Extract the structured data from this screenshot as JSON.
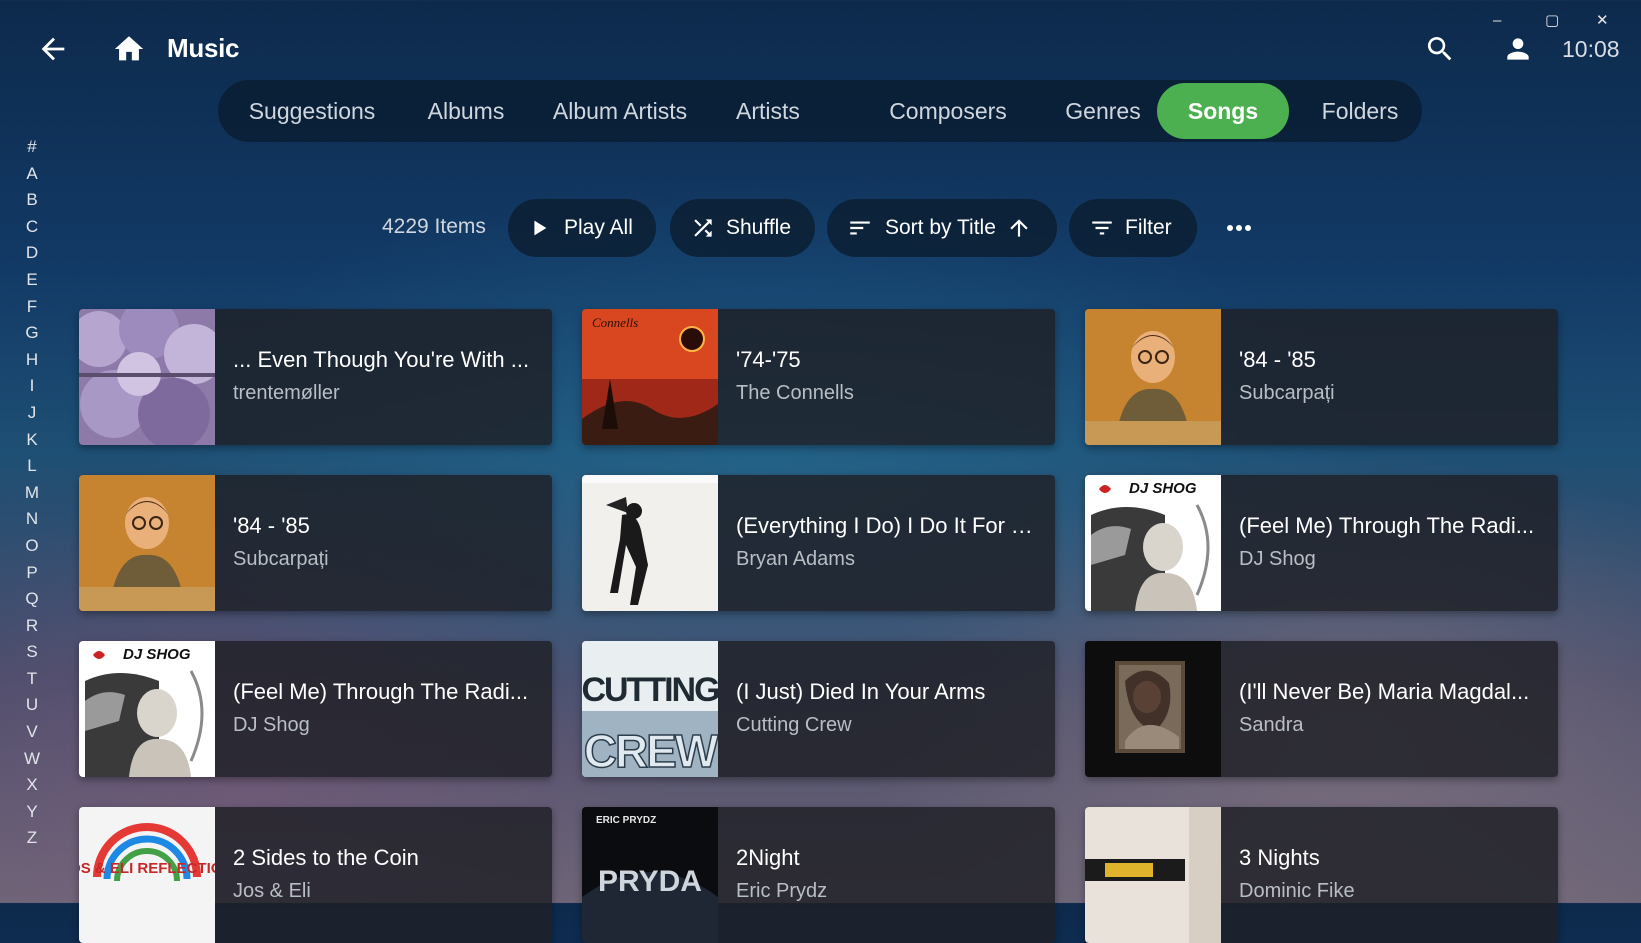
{
  "window": {
    "minimize_glyph": "–",
    "maximize_glyph": "▢",
    "close_glyph": "✕"
  },
  "header": {
    "title": "Music",
    "clock": "10:08",
    "icons": [
      "back-arrow-icon",
      "home-icon",
      "search-icon",
      "user-icon"
    ]
  },
  "tabs": [
    {
      "label": "Suggestions",
      "active": false
    },
    {
      "label": "Albums",
      "active": false
    },
    {
      "label": "Album Artists",
      "active": false
    },
    {
      "label": "Artists",
      "active": false
    },
    {
      "label": "Composers",
      "active": false
    },
    {
      "label": "Genres",
      "active": false
    },
    {
      "label": "Songs",
      "active": true
    },
    {
      "label": "Folders",
      "active": false
    }
  ],
  "alphabet": [
    "#",
    "A",
    "B",
    "C",
    "D",
    "E",
    "F",
    "G",
    "H",
    "I",
    "J",
    "K",
    "L",
    "M",
    "N",
    "O",
    "P",
    "Q",
    "R",
    "S",
    "T",
    "U",
    "V",
    "W",
    "X",
    "Y",
    "Z"
  ],
  "toolbar": {
    "count": "4229 Items",
    "play_all": "Play All",
    "shuffle": "Shuffle",
    "sort": "Sort by Title",
    "filter": "Filter",
    "more_glyph": "•••"
  },
  "colors": {
    "accent": "#4caf50",
    "tabbar_bg": "#0b1d30"
  },
  "songs": [
    {
      "title": "... Even Though You're With ...",
      "artist": "trentemøller",
      "art": "purple-smoke-art",
      "art_text": ""
    },
    {
      "title": "'74-'75",
      "artist": "The Connells",
      "art": "connells-ring-art",
      "art_text": "Connells"
    },
    {
      "title": "'84 - '85",
      "artist": "Subcarpați",
      "art": "child-portrait-art",
      "art_text": ""
    },
    {
      "title": "'84 - '85",
      "artist": "Subcarpați",
      "art": "child-portrait-art",
      "art_text": ""
    },
    {
      "title": "(Everything I Do) I Do It For Y...",
      "artist": "Bryan Adams",
      "art": "bryan-adams-art",
      "art_text": ""
    },
    {
      "title": "(Feel Me) Through The Radi...",
      "artist": "DJ Shog",
      "art": "dj-shog-art",
      "art_text": "DJ SHOG"
    },
    {
      "title": "(Feel Me) Through The Radi...",
      "artist": "DJ Shog",
      "art": "dj-shog-art",
      "art_text": "DJ SHOG"
    },
    {
      "title": "(I Just) Died In Your Arms",
      "artist": "Cutting Crew",
      "art": "cutting-crew-art",
      "art_text": "CUTTING CREW"
    },
    {
      "title": "(I'll Never Be) Maria Magdal...",
      "artist": "Sandra",
      "art": "sandra-portrait-art",
      "art_text": ""
    },
    {
      "title": "2 Sides to the Coin",
      "artist": "Jos & Eli",
      "art": "jos-eli-reflection-art",
      "art_text": "JOS & ELI REFLECTION"
    },
    {
      "title": "2Night",
      "artist": "Eric Prydz",
      "art": "pryda-art",
      "art_text": "PRYDA"
    },
    {
      "title": "3 Nights",
      "artist": "Dominic Fike",
      "art": "dominic-fike-art",
      "art_text": ""
    }
  ]
}
